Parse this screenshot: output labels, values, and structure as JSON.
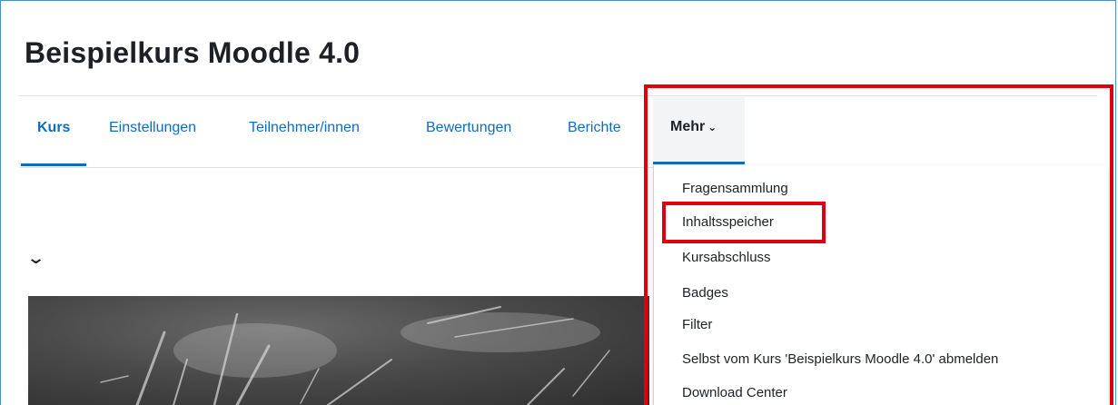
{
  "page": {
    "title": "Beispielkurs Moodle 4.0"
  },
  "nav": {
    "items": [
      {
        "label": "Kurs"
      },
      {
        "label": "Einstellungen"
      },
      {
        "label": "Teilnehmer/innen"
      },
      {
        "label": "Bewertungen"
      },
      {
        "label": "Berichte"
      }
    ],
    "more": {
      "label": "Mehr",
      "icon": "chevron-down-icon"
    }
  },
  "menu": {
    "items": [
      {
        "label": "Fragensammlung"
      },
      {
        "label": "Inhaltsspeicher"
      },
      {
        "label": "Kursabschluss"
      },
      {
        "label": "Badges"
      },
      {
        "label": "Filter"
      },
      {
        "label": "Selbst vom Kurs 'Beispielkurs Moodle 4.0' abmelden"
      },
      {
        "label": "Download Center"
      }
    ]
  },
  "section": {
    "collapse_icon": "chevron-down-icon"
  },
  "colors": {
    "accent": "#0f6cbf",
    "highlight": "#e0000b",
    "text": "#1d2125"
  }
}
